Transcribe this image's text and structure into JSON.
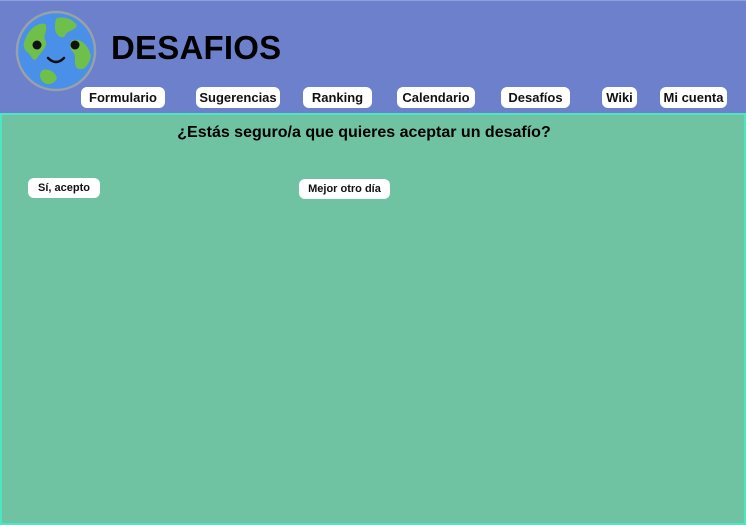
{
  "header": {
    "title": "DESAFIOS",
    "logo_icon": "earth-smiley-icon"
  },
  "nav": {
    "items": [
      {
        "id": "formulario",
        "label": "Formulario"
      },
      {
        "id": "sugerencias",
        "label": "Sugerencias"
      },
      {
        "id": "ranking",
        "label": "Ranking"
      },
      {
        "id": "calendario",
        "label": "Calendario"
      },
      {
        "id": "desafios",
        "label": "Desafíos"
      },
      {
        "id": "wiki",
        "label": "Wiki"
      },
      {
        "id": "mi-cuenta",
        "label": "Mi cuenta"
      }
    ]
  },
  "main": {
    "question": "¿Estás seguro/a que quieres aceptar un desafío?",
    "accept_label": "Sí, acepto",
    "decline_label": "Mejor otro día"
  },
  "colors": {
    "header_bg": "#6d80cb",
    "content_bg": "#6fc2a2",
    "content_border": "#4ee6c2",
    "button_bg": "#ffffff"
  }
}
